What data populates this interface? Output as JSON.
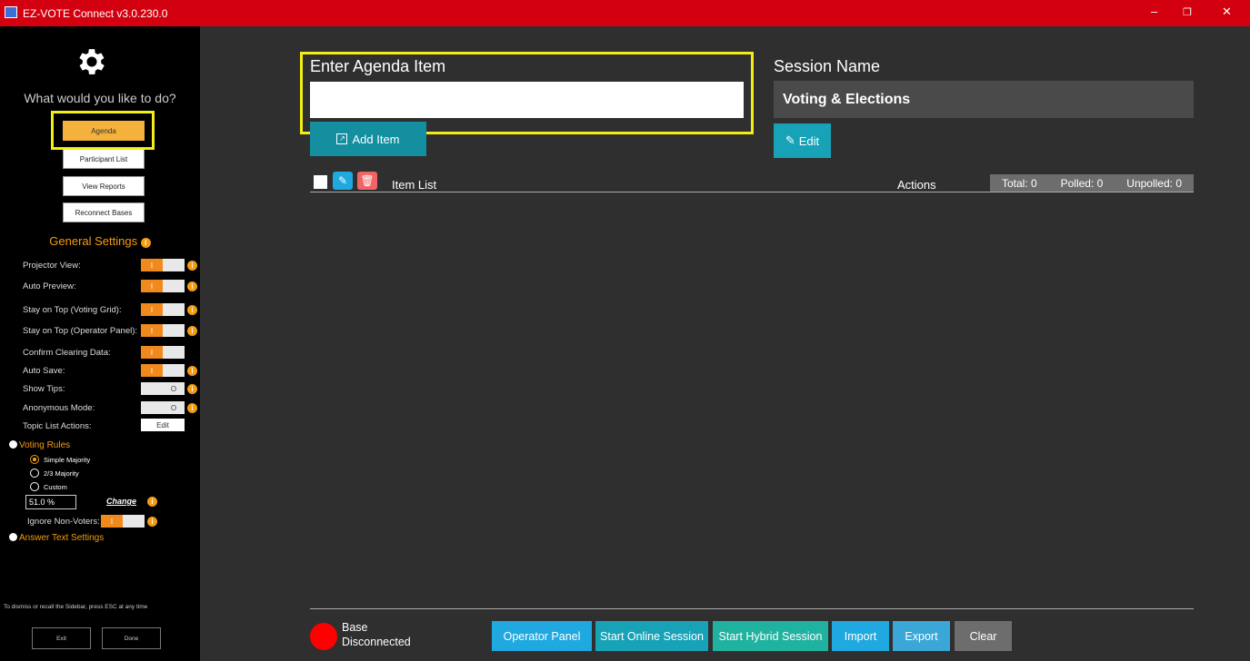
{
  "window": {
    "title": "EZ-VOTE Connect v3.0.230.0",
    "minimize": "–",
    "restore": "❐",
    "close": "✕"
  },
  "sidebar": {
    "prompt": "What would you like to do?",
    "nav": [
      "Agenda",
      "Participant List",
      "View Reports",
      "Reconnect Bases"
    ],
    "active_nav": "Agenda",
    "general_settings_label": "General Settings",
    "settings": [
      {
        "label": "Projector View:",
        "state": "on",
        "info": true
      },
      {
        "label": "Auto Preview:",
        "state": "on",
        "info": true
      },
      {
        "label": "Stay on Top (Voting Grid):",
        "state": "on",
        "info": true
      },
      {
        "label": "Stay on Top (Operator Panel):",
        "state": "on",
        "info": true
      },
      {
        "label": "Confirm Clearing Data:",
        "state": "on",
        "info": false
      },
      {
        "label": "Auto Save:",
        "state": "on",
        "info": true
      },
      {
        "label": "Show Tips:",
        "state": "off",
        "info": true
      },
      {
        "label": "Anonymous Mode:",
        "state": "off",
        "info": true
      }
    ],
    "toggle_on_glyph": "I",
    "toggle_off_glyph": "O",
    "topic_actions_label": "Topic List Actions:",
    "topic_actions_button": "Edit",
    "voting_rules_label": "Voting Rules",
    "voting_rules": [
      "Simple Majority",
      "2/3 Majority",
      "Custom"
    ],
    "selected_rule": "Simple Majority",
    "percent_value": "51.0 %",
    "change_label": "Change",
    "ignore_non_voters_label": "Ignore Non-Voters:",
    "answer_text_label": "Answer Text Settings",
    "hint": "To dismiss or recall the Sidebar, press ESC at any time",
    "exit_label": "Exit",
    "done_label": "Done"
  },
  "main": {
    "agenda_title": "Enter Agenda Item",
    "agenda_input_value": "",
    "add_item_label": "Add Item",
    "session_title": "Session Name",
    "session_name": "Voting & Elections",
    "edit_label": "Edit",
    "item_list_label": "Item List",
    "actions_label": "Actions",
    "stats": {
      "total": "Total: 0",
      "polled": "Polled: 0",
      "unpolled": "Unpolled: 0"
    }
  },
  "footer": {
    "status": "Base Disconnected",
    "status_color": "#ff0000",
    "buttons": [
      "Operator Panel",
      "Start Online Session",
      "Start Hybrid Session",
      "Import",
      "Export",
      "Clear"
    ]
  },
  "colors": {
    "titlebar": "#d3000f",
    "accent": "#f39c12",
    "teal": "#17a2b8",
    "highlight": "#f3ef14"
  }
}
